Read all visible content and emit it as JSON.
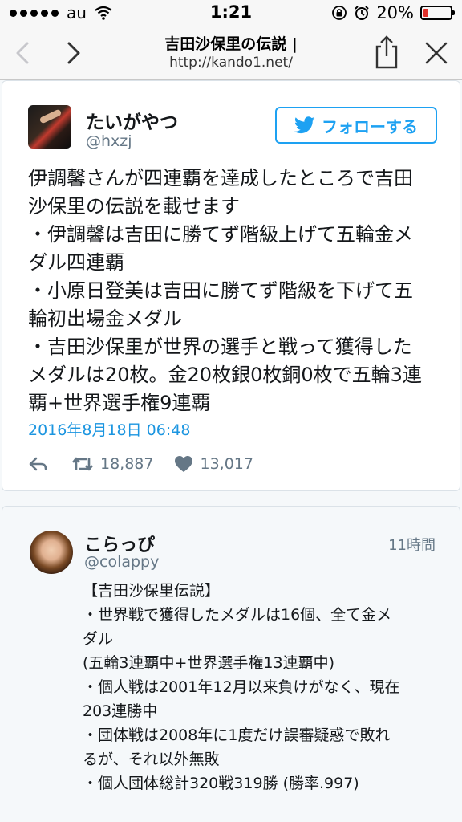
{
  "status_bar": {
    "carrier": "au",
    "time": "1:21",
    "battery_percent": "20%",
    "battery_level": 0.2
  },
  "browser": {
    "title": "吉田沙保里の伝説 |",
    "url": "http://kando1.net/",
    "back_icon": "chevron-left-icon",
    "forward_icon": "chevron-right-icon",
    "share_icon": "share-icon",
    "close_icon": "close-icon"
  },
  "tweet": {
    "display_name": "たいがやつ",
    "handle": "@hxzj",
    "follow_label": "フォローする",
    "text_lines": [
      "伊調馨さんが四連覇を達成したところで吉田",
      "沙保里の伝説を載せます",
      "・伊調馨は吉田に勝てず階級上げて五輪金メ",
      "ダル四連覇",
      "・小原日登美は吉田に勝てず階級を下げて五",
      "輪初出場金メダル",
      "・吉田沙保里が世界の選手と戦って獲得した",
      "メダルは20枚。金20枚銀0枚銅0枚で五輪3連",
      "覇+世界選手権9連覇"
    ],
    "date": "2016年8月18日 06:48",
    "retweets": "18,887",
    "likes": "13,017"
  },
  "reply": {
    "display_name": "こらっぴ",
    "handle": "@colappy",
    "time_ago": "11時間",
    "text_lines": [
      "【吉田沙保里伝説】",
      "・世界戦で獲得したメダルは16個、全て金メ",
      "ダル",
      "(五輪3連覇中+世界選手権13連覇中)",
      "・個人戦は2001年12月以来負けがなく、現在",
      "203連勝中",
      "・団体戦は2008年に1度だけ誤審疑惑で敗れ",
      "るが、それ以外無敗",
      "・個人団体総計320戦319勝 (勝率.997)"
    ]
  },
  "colors": {
    "twitter_blue": "#1da1f2",
    "link_blue": "#1b95e0",
    "text": "#14171a",
    "muted": "#657786"
  }
}
